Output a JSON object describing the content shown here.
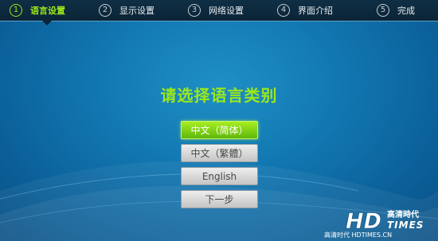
{
  "steps": [
    {
      "num": "1",
      "label": "语言设置",
      "active": true
    },
    {
      "num": "2",
      "label": "显示设置",
      "active": false
    },
    {
      "num": "3",
      "label": "网络设置",
      "active": false
    },
    {
      "num": "4",
      "label": "界面介绍",
      "active": false
    },
    {
      "num": "5",
      "label": "完成",
      "active": false
    }
  ],
  "title": "请选择语言类别",
  "options": [
    {
      "label": "中文（简体）",
      "selected": true
    },
    {
      "label": "中文（繁體）",
      "selected": false
    },
    {
      "label": "English",
      "selected": false
    }
  ],
  "next_label": "下一步",
  "watermark": {
    "logo_text": "HD",
    "logo_cn": "高清時代",
    "logo_en": "TIMES",
    "url": "高清时代 HDTIMES.CN"
  },
  "colors": {
    "accent_green": "#9be81a",
    "background_blue": "#137ab4",
    "stepbar_dark": "#0b2436"
  }
}
